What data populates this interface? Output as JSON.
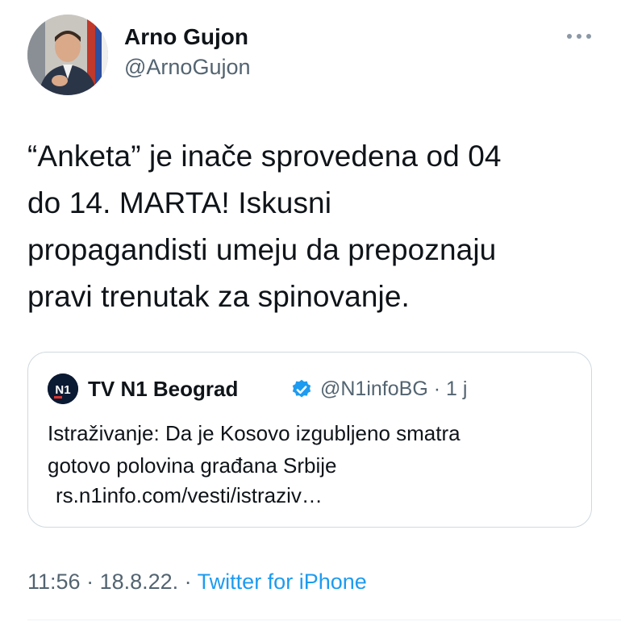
{
  "author": {
    "name": "Arno Gujon",
    "handle": "@ArnoGujon",
    "avatar_icon": "profile-photo"
  },
  "more_icon": "more-options-icon",
  "tweet": {
    "text_lines": [
      "“Anketa” je inače sprovedena od 04",
      "do 14. MARTA! Iskusni",
      "propagandisti umeju da prepoznaju",
      "pravi trenutak za spinovanje."
    ]
  },
  "quote": {
    "name": "TV N1 Beograd",
    "handle_time": "@N1infoBG · 1 j",
    "verified_icon": "verified-badge-icon",
    "text_lines": [
      "Istraživanje: Da je Kosovo izgubljeno smatra",
      "gotovo polovina građana Srbije"
    ],
    "link": "rs.n1info.com/vesti/istraziv…"
  },
  "meta": {
    "time": "11:56",
    "sep1": " · ",
    "date": "18.8.22.",
    "sep2": " · ",
    "source": "Twitter for iPhone"
  },
  "colors": {
    "text": "#0f1419",
    "secondary": "#536471",
    "link": "#1d9bf0",
    "border": "#cfd9de"
  }
}
